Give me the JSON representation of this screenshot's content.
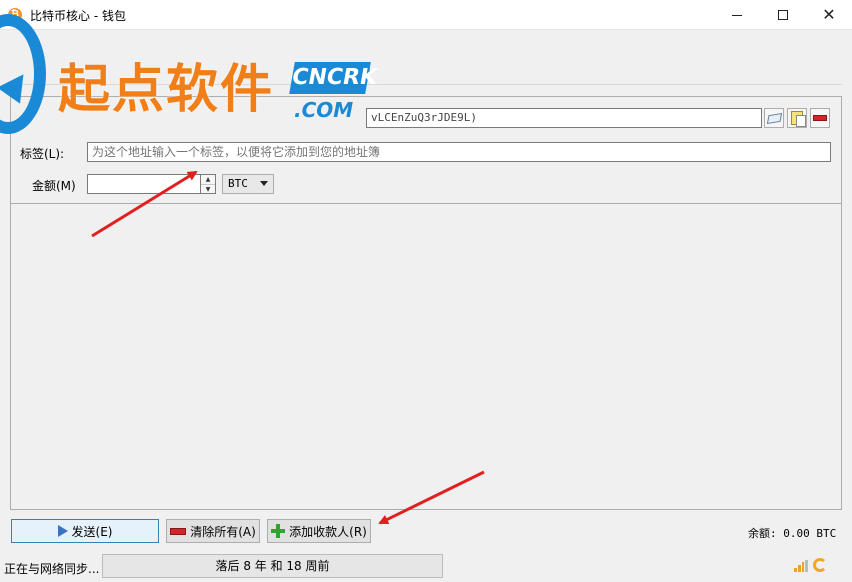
{
  "window": {
    "title": "比特币核心 - 钱包",
    "app_icon": "bitcoin-icon",
    "minimize_icon": "minimize-icon",
    "maximize_icon": "maximize-icon",
    "close_icon": "close-icon"
  },
  "watermark": {
    "chinese": "起点软件",
    "badge_top": "CNCRK",
    "badge_bottom": ".COM"
  },
  "menu": {
    "partial_visible": ")"
  },
  "recipient": {
    "pay_to_value": "vLCEnZuQ3rJDE9L)",
    "label_label": "标签(L):",
    "label_placeholder": "为这个地址输入一个标签，以便将它添加到您的地址簿",
    "amount_label": "金额(M)",
    "amount_value": "",
    "unit": "BTC"
  },
  "buttons": {
    "send": "发送(E)",
    "clear_all": "清除所有(A)",
    "add_recipient": "添加收款人(R)"
  },
  "balance": "余额: 0.00 BTC",
  "status": {
    "text": "正在与网络同步...",
    "progress": "落后 8 年 和 18 周前"
  },
  "colors": {
    "watermark_orange": "#f07f1a",
    "watermark_blue": "#1a8ad6",
    "annotation_red": "#e02020",
    "send_button_border": "#3c7fb1"
  }
}
